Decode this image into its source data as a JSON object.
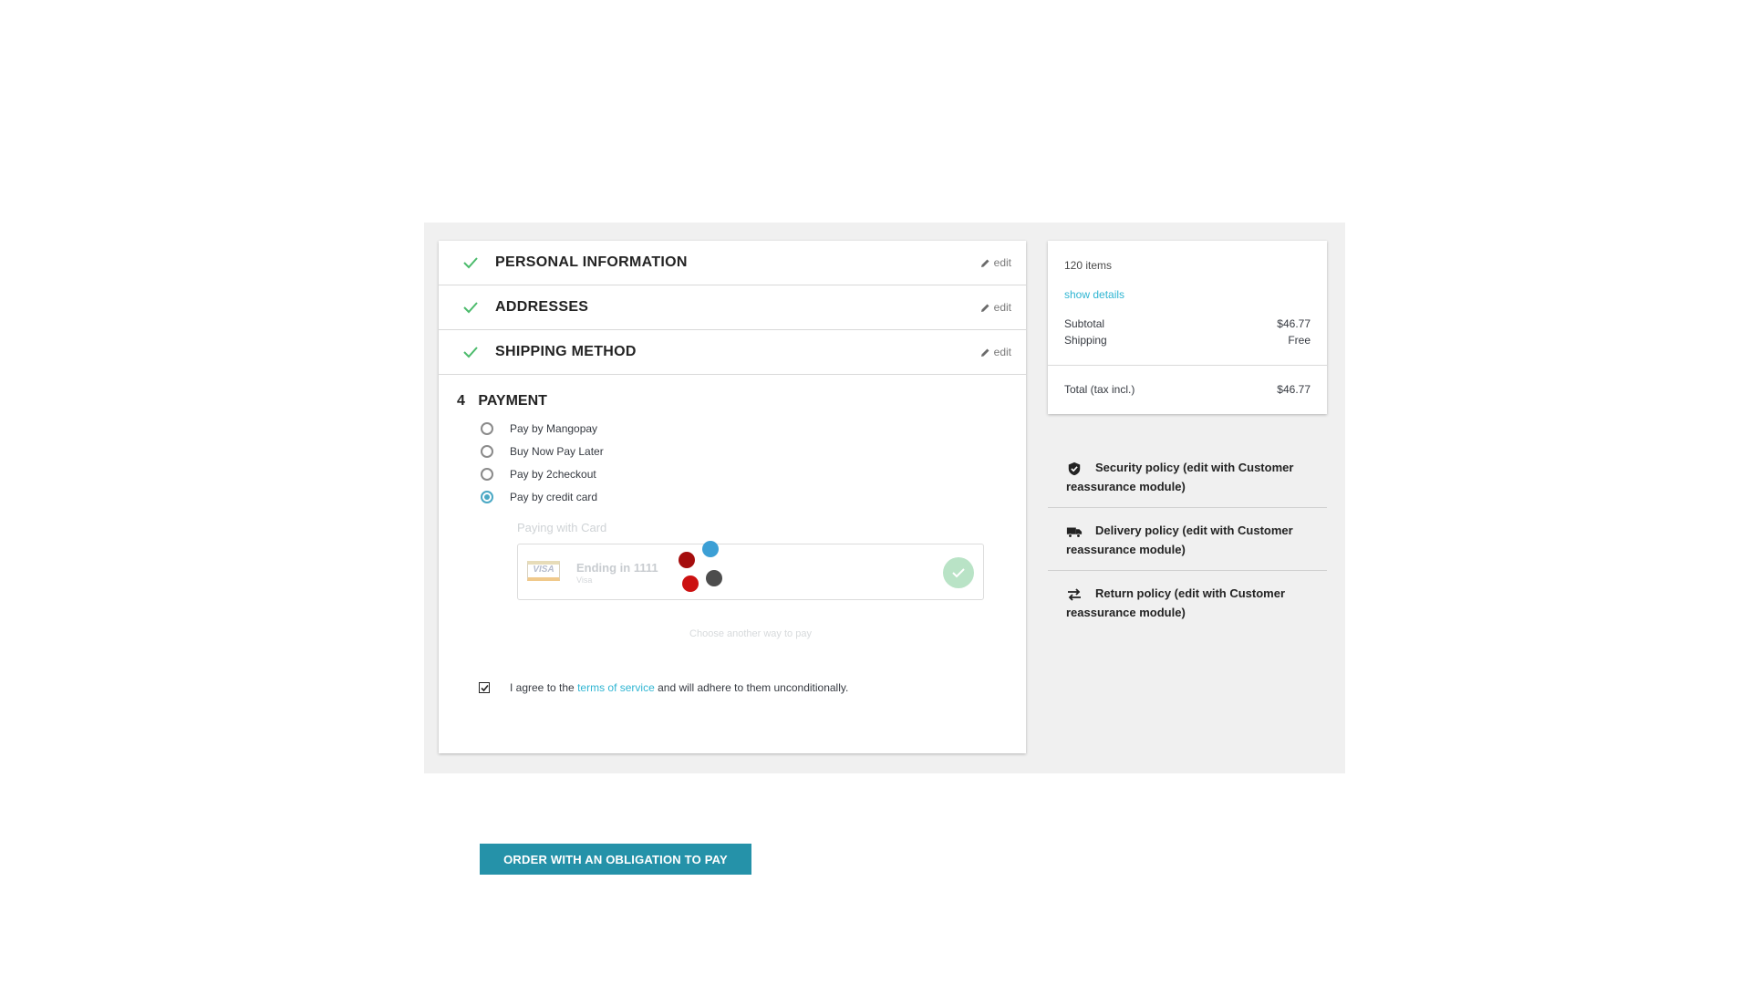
{
  "steps": [
    {
      "title": "PERSONAL INFORMATION",
      "edit_label": "edit"
    },
    {
      "title": "ADDRESSES",
      "edit_label": "edit"
    },
    {
      "title": "SHIPPING METHOD",
      "edit_label": "edit"
    }
  ],
  "payment": {
    "step_number": "4",
    "title": "PAYMENT",
    "options": [
      {
        "label": "Pay by Mangopay",
        "selected": false
      },
      {
        "label": "Buy Now Pay Later",
        "selected": false
      },
      {
        "label": "Pay by 2checkout",
        "selected": false
      },
      {
        "label": "Pay by credit card",
        "selected": true
      }
    ],
    "card_section_label": "Paying with Card",
    "card": {
      "logo": "VISA",
      "ending": "Ending in 1111",
      "brand": "Visa"
    },
    "choose_another": "Choose another way to pay",
    "agree": {
      "checked": true,
      "prefix": "I agree to the",
      "link": "terms of service",
      "suffix": "and will adhere to them unconditionally."
    },
    "order_button": "ORDER WITH AN OBLIGATION TO PAY"
  },
  "summary": {
    "items_count": "120 items",
    "show_details": "show details",
    "subtotal_label": "Subtotal",
    "subtotal_value": "$46.77",
    "shipping_label": "Shipping",
    "shipping_value": "Free",
    "total_label": "Total (tax incl.)",
    "total_value": "$46.77"
  },
  "reassurance": [
    {
      "icon": "shield-icon",
      "text": "Security policy (edit with Customer reassurance module)"
    },
    {
      "icon": "truck-icon",
      "text": "Delivery policy (edit with Customer reassurance module)"
    },
    {
      "icon": "exchange-arrows-icon",
      "text": "Return policy (edit with Customer reassurance module)"
    }
  ],
  "colors": {
    "accent": "#2fb5d2",
    "button": "#2592a9",
    "check_green": "#4cbb6c",
    "decor_dots": [
      "#a50d0d",
      "#3c9fd5",
      "#cc1111",
      "#4d4d4d"
    ]
  }
}
